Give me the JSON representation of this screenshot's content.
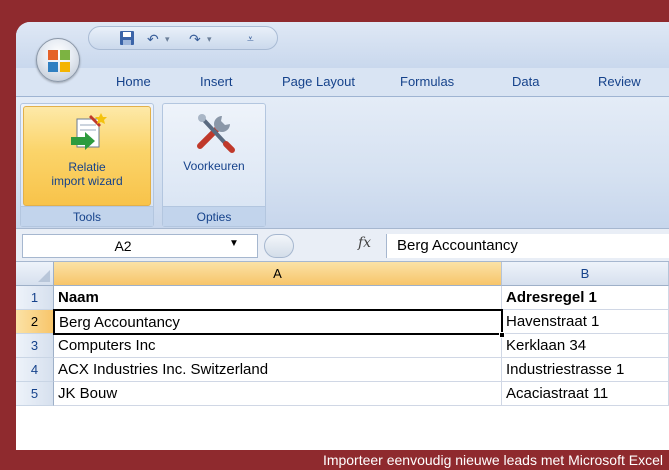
{
  "qat": {
    "save_icon": "save-icon",
    "undo_icon": "undo-icon",
    "redo_icon": "redo-icon",
    "customize_icon": "customize-icon"
  },
  "tabs": [
    "Home",
    "Insert",
    "Page Layout",
    "Formulas",
    "Data",
    "Review"
  ],
  "ribbon": {
    "groups": [
      {
        "label": "Tools",
        "button": {
          "line1": "Relatie",
          "line2": "import wizard",
          "icon": "import-wizard-icon"
        }
      },
      {
        "label": "Opties",
        "button": {
          "line1": "Voorkeuren",
          "icon": "tools-icon"
        }
      }
    ]
  },
  "formula_bar": {
    "name_box": "A2",
    "fx": "fx",
    "content": "Berg Accountancy"
  },
  "grid": {
    "columns": [
      "A",
      "B"
    ],
    "rows": [
      {
        "num": "1",
        "a": "Naam",
        "b": "Adresregel 1"
      },
      {
        "num": "2",
        "a": "Berg Accountancy",
        "b": "Havenstraat 1"
      },
      {
        "num": "3",
        "a": "Computers Inc",
        "b": "Kerklaan 34"
      },
      {
        "num": "4",
        "a": "ACX Industries Inc. Switzerland",
        "b": "Industriestrasse 1"
      },
      {
        "num": "5",
        "a": "JK Bouw",
        "b": "Acaciastraat 11"
      }
    ]
  },
  "caption": "Importeer eenvoudig nieuwe leads met Microsoft Excel",
  "colors": {
    "frame": "#8f2a2e",
    "ribbon_blue": "#d5e1f1",
    "active_orange": "#f8c34a",
    "label_blue": "#15428b"
  }
}
